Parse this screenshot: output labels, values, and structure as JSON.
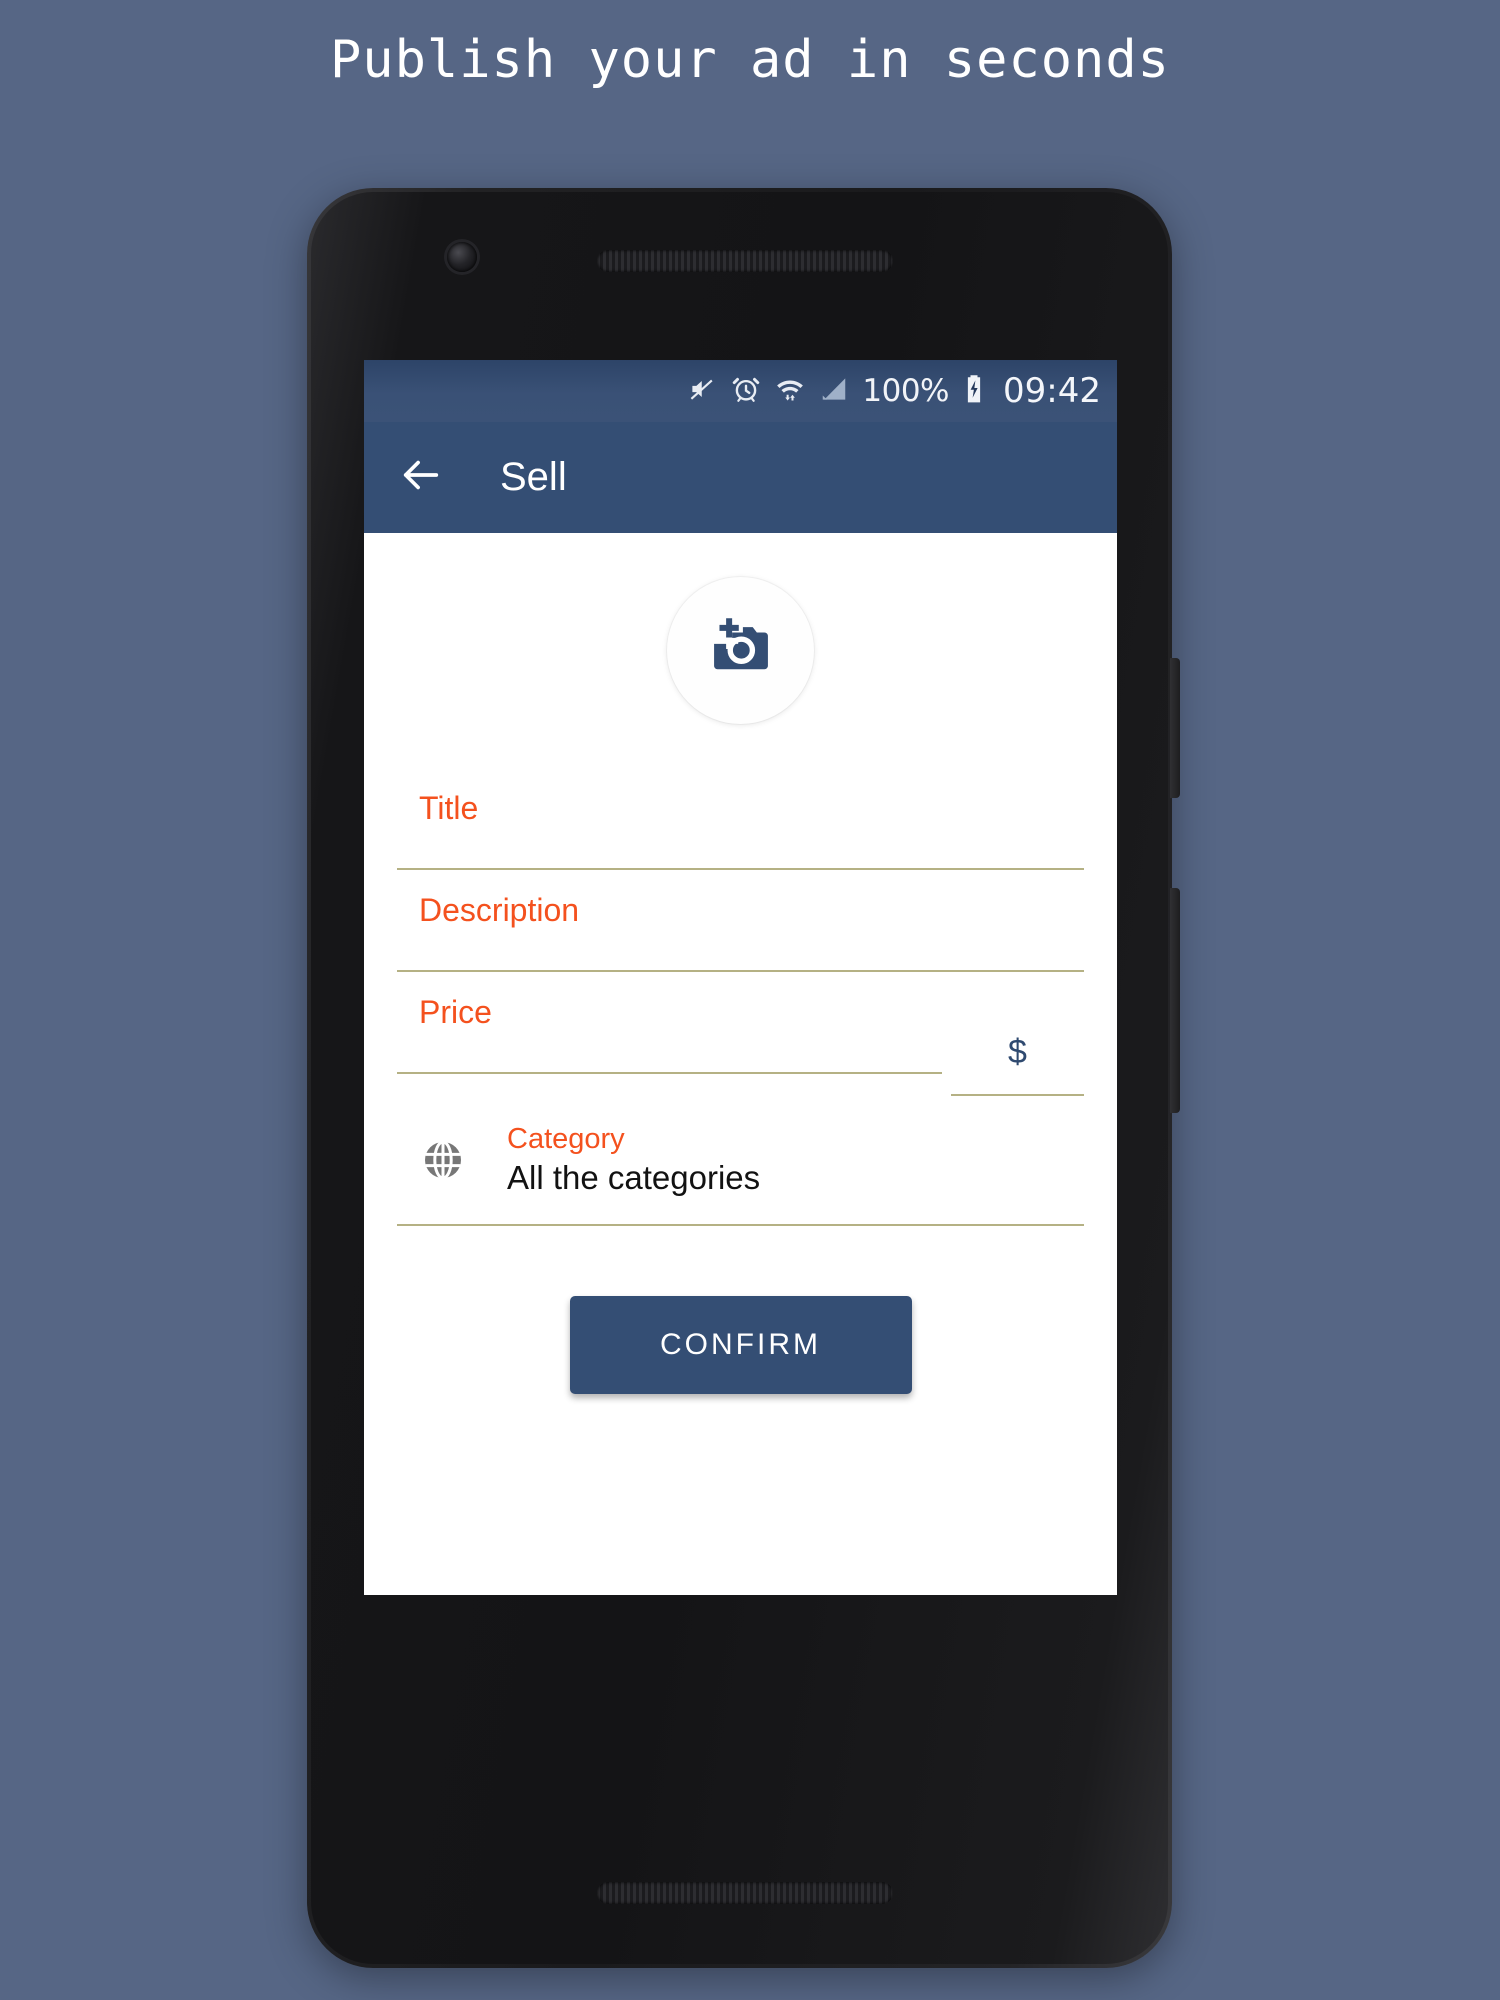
{
  "headline": "Publish your ad in seconds",
  "colors": {
    "page_background": "#566685",
    "app_bar": "#344e74",
    "status_bar": "#3a5176",
    "accent_orange": "#f4511e",
    "field_underline": "#b5b184",
    "button_blue": "#344e74",
    "camera_icon": "#344e74",
    "globe_icon": "#777777"
  },
  "status_bar": {
    "icons": [
      "mute-icon",
      "alarm-icon",
      "wifi-icon",
      "signal-icon"
    ],
    "battery_percent": "100%",
    "battery_icon": "battery-charging-icon",
    "time": "09:42"
  },
  "app_bar": {
    "back_icon": "back-arrow-icon",
    "title": "Sell"
  },
  "photo": {
    "icon": "add-photo-camera-icon"
  },
  "form": {
    "fields": [
      {
        "label": "Title",
        "value": "",
        "placeholder": ""
      },
      {
        "label": "Description",
        "value": "",
        "placeholder": ""
      },
      {
        "label": "Price",
        "value": "",
        "placeholder": ""
      }
    ],
    "currency": {
      "symbol": "$"
    },
    "category": {
      "icon": "globe-icon",
      "label": "Category",
      "value": "All the categories"
    }
  },
  "actions": {
    "confirm_label": "CONFIRM"
  }
}
